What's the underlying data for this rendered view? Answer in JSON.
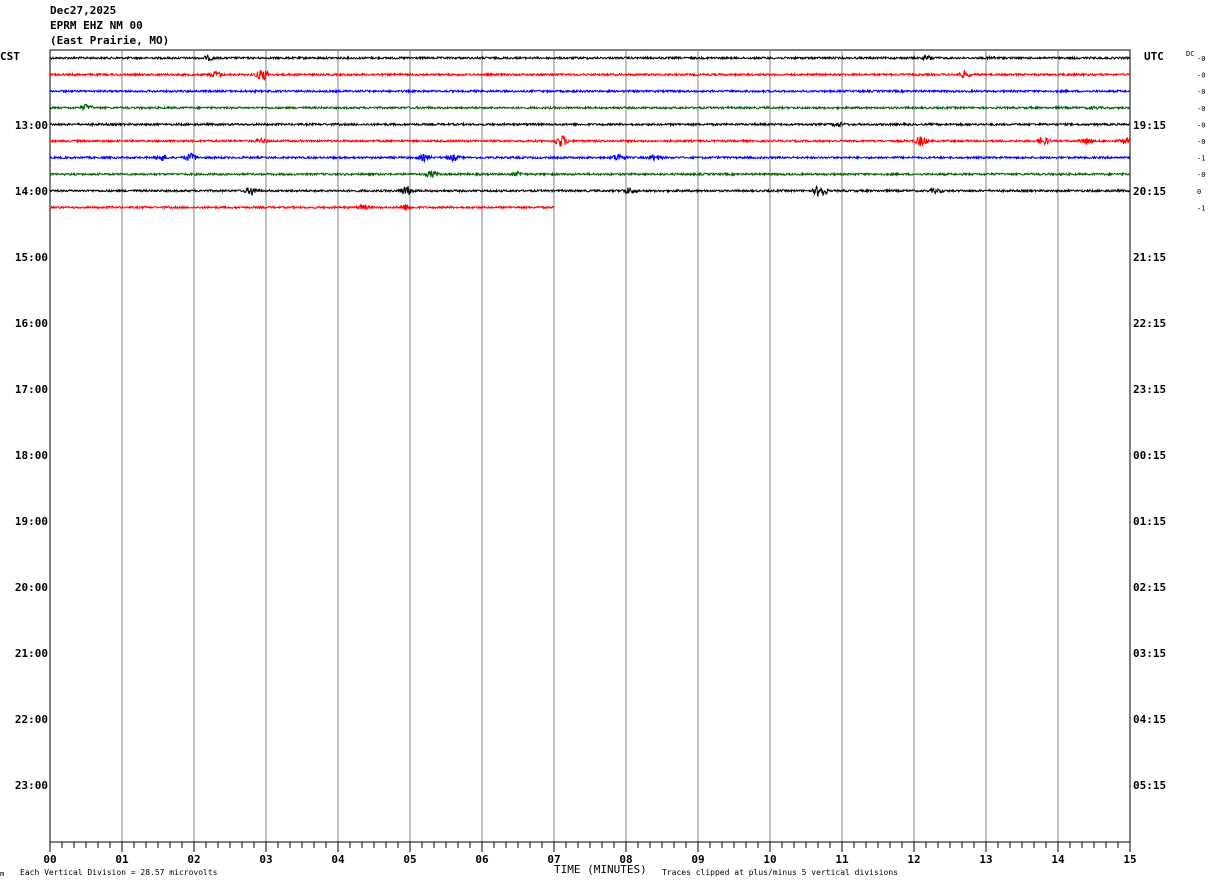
{
  "header": {
    "date": "Dec27,2025",
    "station": "EPRM EHZ NM 00",
    "location": "(East Prairie, MO)"
  },
  "left_axis_label": "CST",
  "right_axis_label": "UTC",
  "dc_label": "DC",
  "footer": {
    "mark": "m",
    "scale_note": "Each Vertical Division =   28.57 microvolts",
    "xlabel": "TIME (MINUTES)",
    "clip_note": "Traces clipped at plus/minus 5 vertical divisions"
  },
  "chart_data": {
    "type": "line",
    "title": "EPRM EHZ NM 00",
    "xlabel": "TIME (MINUTES)",
    "xlim": [
      0,
      15
    ],
    "x_ticks": [
      "00",
      "01",
      "02",
      "03",
      "04",
      "05",
      "06",
      "07",
      "08",
      "09",
      "10",
      "11",
      "12",
      "13",
      "14",
      "15"
    ],
    "left_hour_labels": [
      "13:00",
      "14:00",
      "15:00",
      "16:00",
      "17:00",
      "18:00",
      "19:00",
      "20:00",
      "21:00",
      "22:00",
      "23:00"
    ],
    "right_hour_labels": [
      "19:15",
      "20:15",
      "21:15",
      "22:15",
      "23:15",
      "00:15",
      "01:15",
      "02:15",
      "03:15",
      "04:15",
      "05:15"
    ],
    "colors": {
      "black": "#000000",
      "red": "#ff0000",
      "blue": "#0000ff",
      "green": "#006400"
    },
    "traces": [
      {
        "color": "black",
        "end_minute": 15,
        "dc": "-0",
        "events": [
          [
            2.2,
            2
          ],
          [
            12.2,
            2
          ],
          [
            13.1,
            1
          ]
        ]
      },
      {
        "color": "red",
        "end_minute": 15,
        "dc": "-0",
        "events": [
          [
            2.3,
            3
          ],
          [
            2.95,
            6
          ],
          [
            12.7,
            3
          ]
        ]
      },
      {
        "color": "blue",
        "end_minute": 15,
        "dc": "-0",
        "events": []
      },
      {
        "color": "green",
        "end_minute": 15,
        "dc": "-0",
        "events": [
          [
            0.5,
            3
          ],
          [
            14.5,
            1
          ]
        ]
      },
      {
        "color": "black",
        "end_minute": 15,
        "dc": "-0",
        "events": [
          [
            10.95,
            2
          ]
        ]
      },
      {
        "color": "red",
        "end_minute": 15,
        "dc": "-0",
        "events": [
          [
            2.95,
            2
          ],
          [
            7.1,
            6
          ],
          [
            12.1,
            5
          ],
          [
            13.8,
            4
          ],
          [
            14.4,
            3
          ],
          [
            14.95,
            3
          ]
        ]
      },
      {
        "color": "blue",
        "end_minute": 15,
        "dc": "-1",
        "events": [
          [
            1.55,
            3
          ],
          [
            1.95,
            4
          ],
          [
            5.2,
            3
          ],
          [
            5.6,
            3
          ],
          [
            7.9,
            4
          ],
          [
            8.4,
            3
          ]
        ]
      },
      {
        "color": "green",
        "end_minute": 15,
        "dc": "-0",
        "events": [
          [
            5.3,
            3
          ],
          [
            6.5,
            2
          ]
        ]
      },
      {
        "color": "black",
        "end_minute": 15,
        "dc": "0",
        "events": [
          [
            2.8,
            4
          ],
          [
            4.95,
            5
          ],
          [
            8.05,
            3
          ],
          [
            10.7,
            7
          ],
          [
            12.3,
            2
          ]
        ]
      },
      {
        "color": "red",
        "end_minute": 7,
        "dc": "-1",
        "events": [
          [
            4.35,
            2
          ],
          [
            4.95,
            3
          ]
        ]
      }
    ]
  }
}
